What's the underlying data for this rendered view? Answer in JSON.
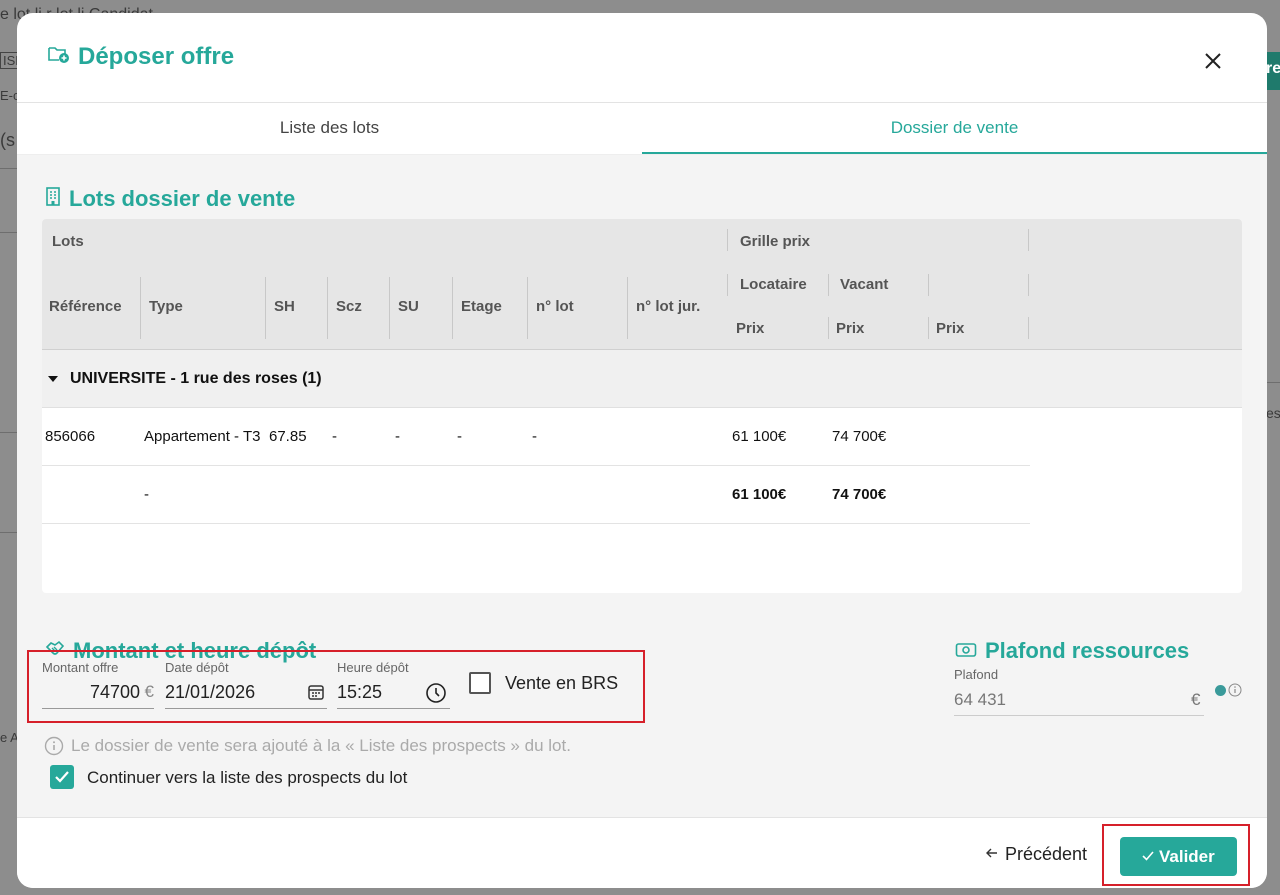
{
  "background": {
    "snippet_top": "e lot  li                        r lot li                   Candidat",
    "snippet_isf": "ISF",
    "snippet_e": "E-c",
    "snippet_s": "(s",
    "snippet_ea": "e A",
    "snippet_es": "es",
    "snippet_green": "re"
  },
  "modal": {
    "title": "Déposer offre",
    "tabs": [
      {
        "label": "Liste des lots",
        "active": false
      },
      {
        "label": "Dossier de vente",
        "active": true
      }
    ]
  },
  "lots": {
    "section_title": "Lots dossier de vente",
    "header_group_lots": "Lots",
    "header_group_grille": "Grille prix",
    "columns": [
      "Référence",
      "Type",
      "SH",
      "Scz",
      "SU",
      "Etage",
      "n° lot",
      "n° lot jur."
    ],
    "subheader_locataire": "Locataire",
    "subheader_vacant": "Vacant",
    "prix_labels": [
      "Prix",
      "Prix",
      "Prix"
    ],
    "group_label": "UNIVERSITE - 1 rue des roses (1)",
    "rows": [
      {
        "reference": "856066",
        "type": "Appartement - T3",
        "sh": "67.85",
        "scz": "-",
        "su": "-",
        "etage": "-",
        "lot": "-",
        "lot_jur": "",
        "locataire": "61 100€",
        "vacant": "74 700€"
      }
    ],
    "total": {
      "type": "-",
      "locataire": "61 100€",
      "vacant": "74 700€"
    }
  },
  "montant": {
    "section_title": "Montant et heure dépôt",
    "montant_label": "Montant offre",
    "montant_value": "74700",
    "montant_currency": "€",
    "date_label": "Date dépôt",
    "date_value": "21/01/2026",
    "heure_label": "Heure dépôt",
    "heure_value": "15:25",
    "brs_label": "Vente en BRS",
    "brs_checked": false,
    "info_text": "Le dossier de vente sera ajouté à la « Liste des prospects » du lot.",
    "continue_label": "Continuer vers la liste des prospects du lot",
    "continue_checked": true
  },
  "plafond": {
    "section_title": "Plafond ressources",
    "label": "Plafond",
    "value": "64 431",
    "currency": "€"
  },
  "footer": {
    "prev_label": "Précédent",
    "valider_label": "Valider"
  },
  "colors": {
    "accent": "#26a89a",
    "highlight": "#d6202a"
  }
}
